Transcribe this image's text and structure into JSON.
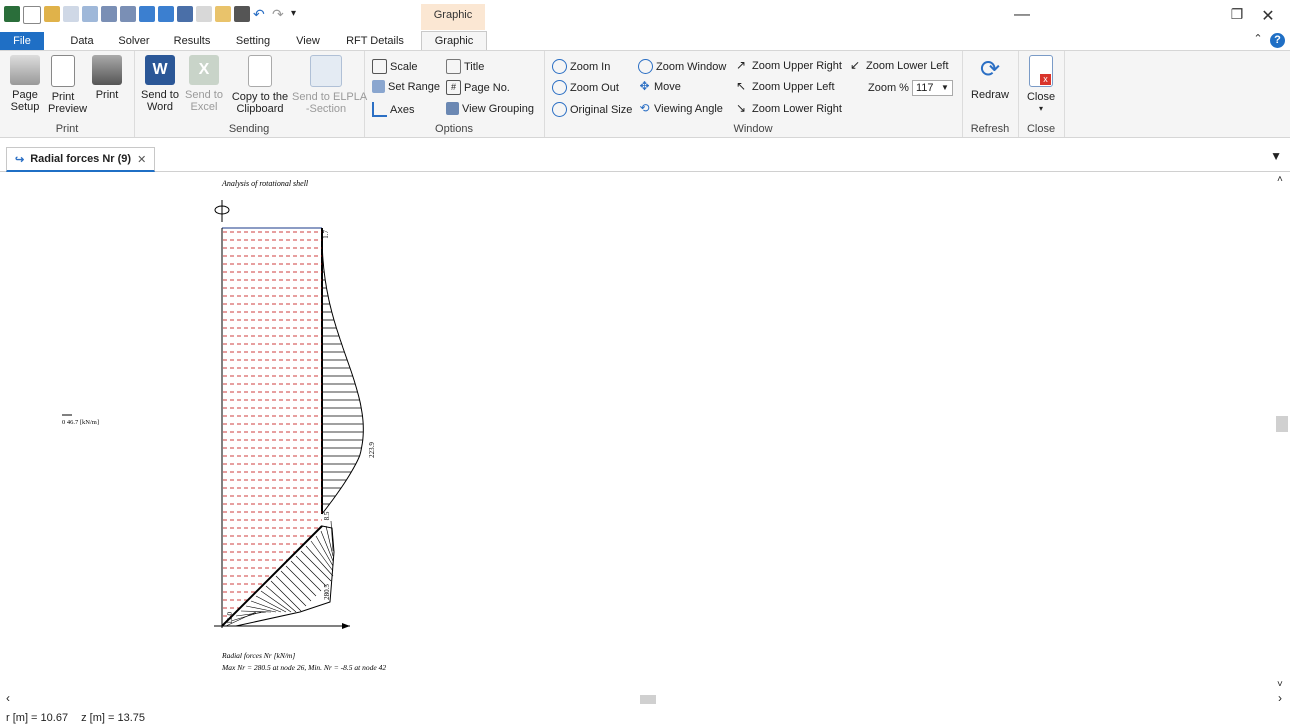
{
  "window": {
    "context_tab": "Graphic",
    "buttons": [
      "—",
      "❐",
      "✕"
    ]
  },
  "ribbon_tabs": [
    {
      "label": "File"
    },
    {
      "label": "Data"
    },
    {
      "label": "Solver"
    },
    {
      "label": "Results"
    },
    {
      "label": "Setting"
    },
    {
      "label": "View"
    },
    {
      "label": "RFT Details"
    },
    {
      "label": "Graphic"
    }
  ],
  "groups": {
    "print": {
      "label": "Print",
      "page_setup": "Page\nSetup",
      "print_preview": "Print\nPreview",
      "print": "Print"
    },
    "sending": {
      "label": "Sending",
      "send_word": "Send to\nWord",
      "send_excel": "Send to\nExcel",
      "copy_clipboard": "Copy to the\nClipboard",
      "send_elpla": "Send to ELPLA\n-Section"
    },
    "options": {
      "label": "Options",
      "scale": "Scale",
      "set_range": "Set Range",
      "axes": "Axes",
      "title": "Title",
      "page_no": "Page No.",
      "view_grouping": "View Grouping"
    },
    "window": {
      "label": "Window",
      "zoom_in": "Zoom In",
      "zoom_out": "Zoom Out",
      "original_size": "Original Size",
      "zoom_window": "Zoom Window",
      "move": "Move",
      "viewing_angle": "Viewing Angle",
      "zoom_upper_right": "Zoom Upper Right",
      "zoom_upper_left": "Zoom Upper Left",
      "zoom_lower_right": "Zoom Lower Right",
      "zoom_lower_left": "Zoom Lower Left",
      "zoom_pct_label": "Zoom %",
      "zoom_pct_value": "117"
    },
    "refresh": {
      "label": "Refresh",
      "redraw": "Redraw"
    },
    "close": {
      "label": "Close",
      "close": "Close"
    }
  },
  "doc_tab": {
    "label": "Radial forces Nr (9)",
    "close": "✕"
  },
  "drawing": {
    "header": "Analysis of rotational shell",
    "scale_label": "0  46.7 [kN/m]",
    "value_top": "1.7",
    "value_peak": "223.9",
    "value_mid": "8.5",
    "value_lower": "280.5",
    "value_bottom": "11.0",
    "footer_line1": "Radial forces Nr [kN/m]",
    "footer_line2": "Max Nr = 280.5 at node 26, Min. Nr = -8.5 at node 42"
  },
  "status": {
    "r": "r [m] = 10.67",
    "z": "z [m] = 13.75"
  },
  "colors": {
    "accent": "#1f6fc5",
    "context": "#fbe7d3",
    "dash": "#c00000"
  }
}
